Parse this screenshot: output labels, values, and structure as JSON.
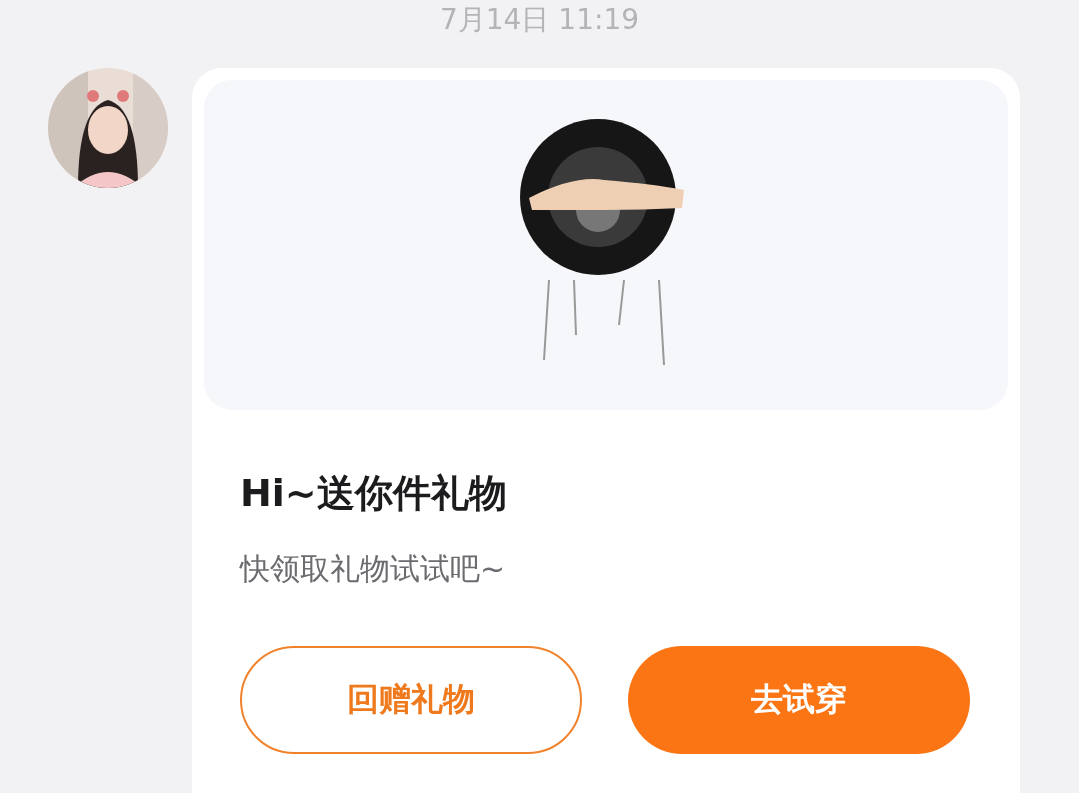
{
  "timestamp": "7月14日 11:19",
  "message": {
    "card": {
      "title": "Hi~送你件礼物",
      "subtitle": "快领取礼物试试吧~",
      "buttons": [
        {
          "label": "回赠礼物",
          "kind": "outline"
        },
        {
          "label": "去试穿",
          "kind": "filled"
        }
      ]
    }
  }
}
